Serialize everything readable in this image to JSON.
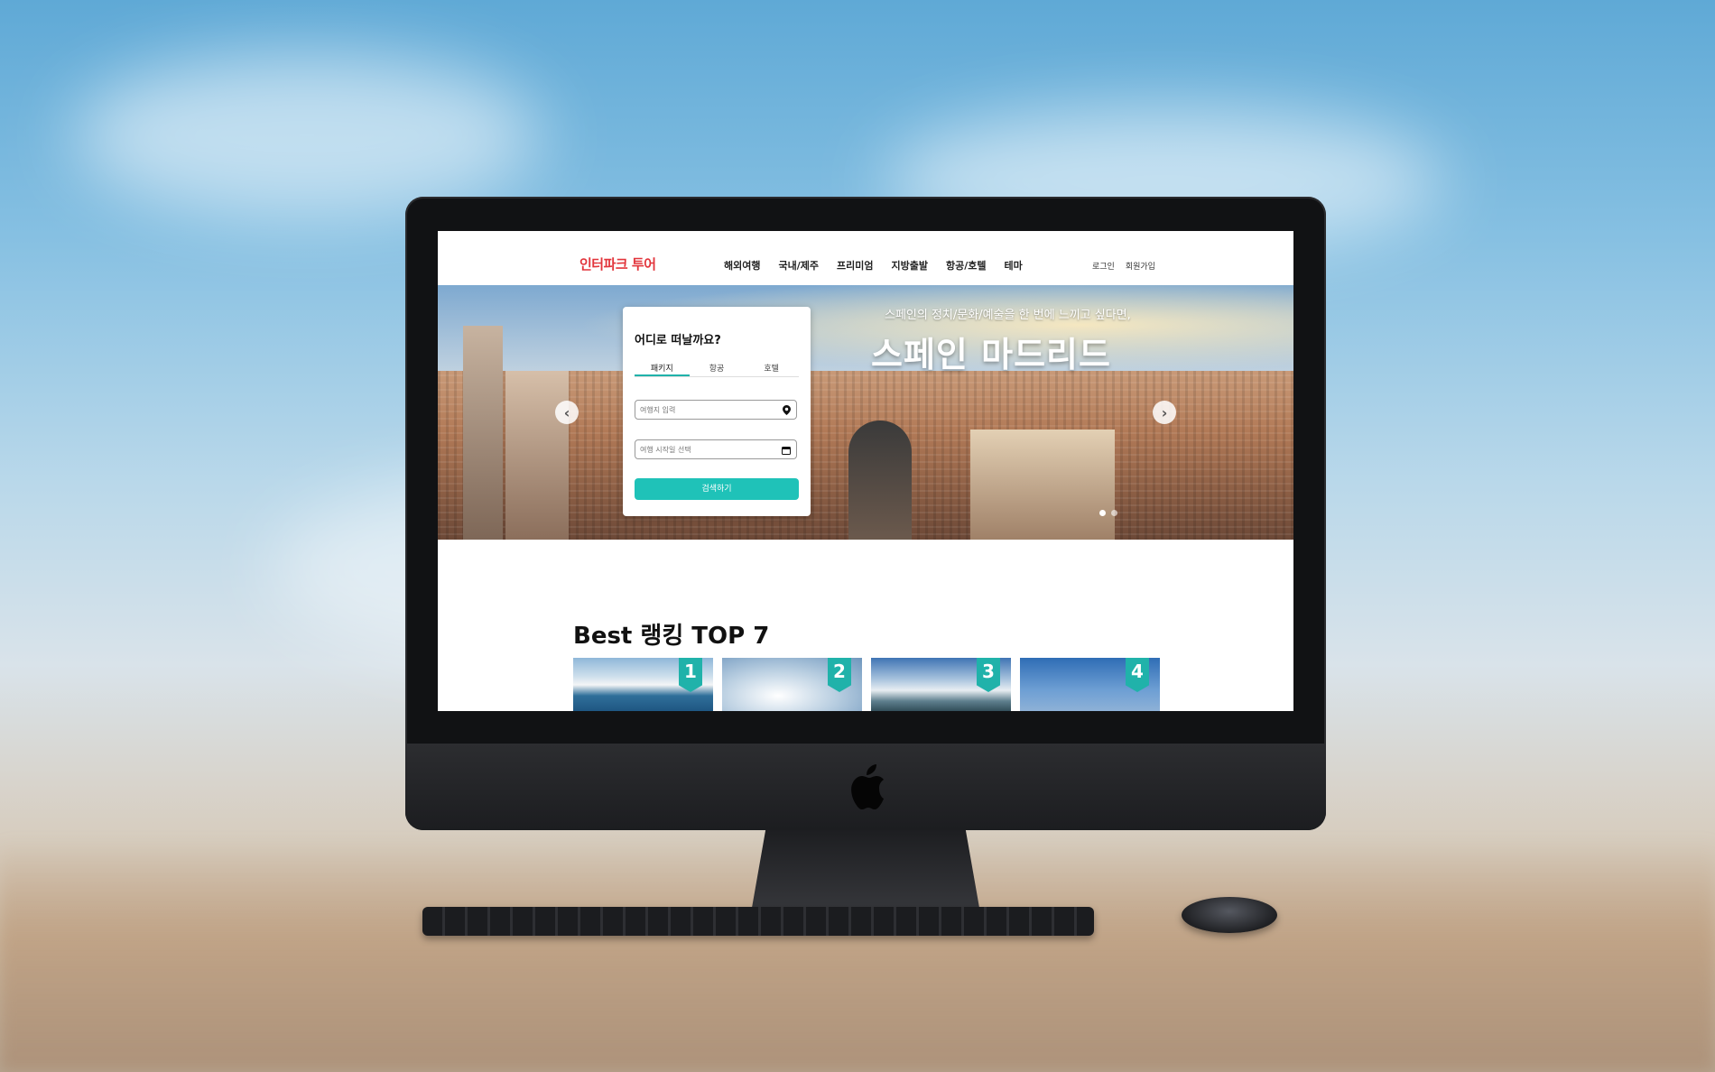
{
  "site": {
    "logo": "인터파크 투어",
    "nav": [
      "해외여행",
      "국내/제주",
      "프리미엄",
      "지방출발",
      "항공/호텔",
      "테마"
    ],
    "auth": {
      "login": "로그인",
      "signup": "회원가입"
    }
  },
  "hero": {
    "subtitle": "스페인의 정치/문화/예술을 한 번에 느끼고 싶다면,",
    "title": "스페인 마드리드",
    "slides_total": 2,
    "active_slide": 1
  },
  "search": {
    "title": "어디로 떠날까요?",
    "tabs": [
      "패키지",
      "항공",
      "호텔"
    ],
    "active_tab": 0,
    "destination_placeholder": "여행지 입력",
    "date_placeholder": "여행 시작일 선택",
    "submit": "검색하기"
  },
  "best": {
    "title": "Best 랭킹 TOP 7",
    "ranks": [
      "1",
      "2",
      "3",
      "4"
    ]
  },
  "colors": {
    "brand": "#e2353c",
    "accent": "#1fc2b8"
  }
}
